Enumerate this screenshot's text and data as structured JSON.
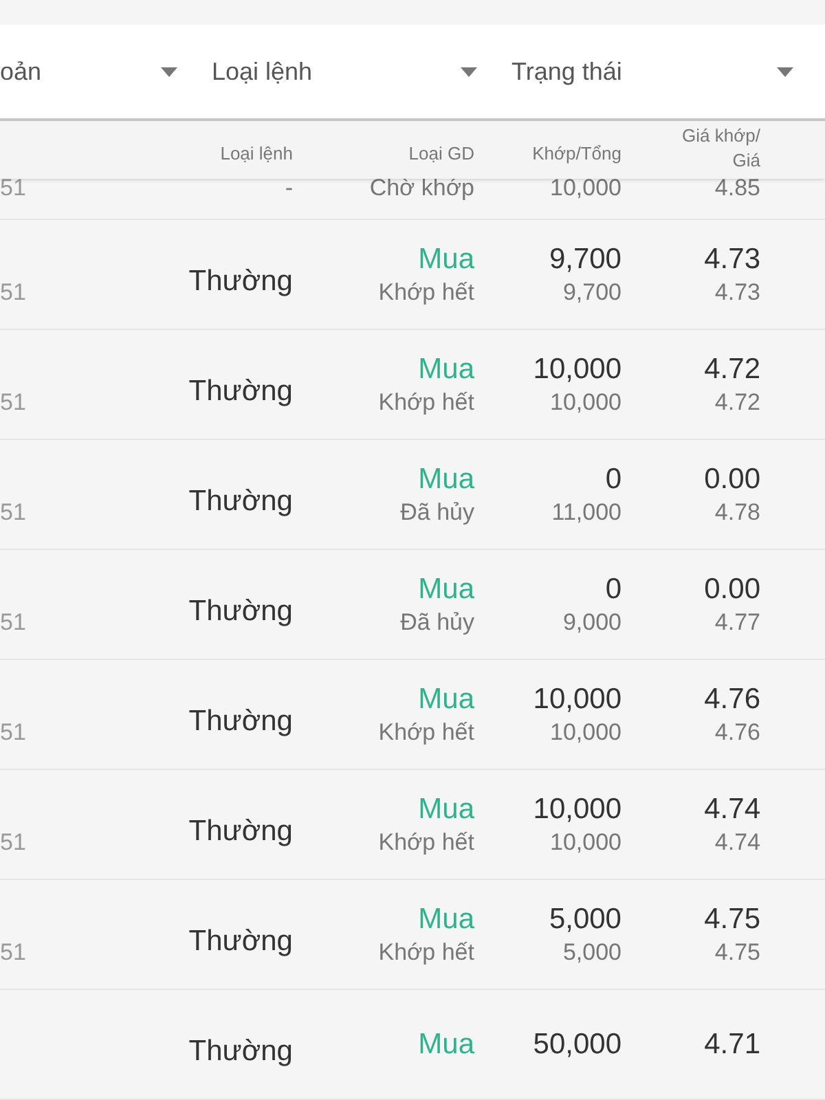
{
  "filters": [
    {
      "label": "oản"
    },
    {
      "label": "Loại lệnh"
    },
    {
      "label": "Trạng thái"
    }
  ],
  "columns": {
    "order_type": "Loại lệnh",
    "trade_type": "Loại GD",
    "quantity": "Khớp/Tổng",
    "price": "Giá khớp/\nGiá"
  },
  "partial_row": {
    "column_1": "51",
    "order_type": "-",
    "status": "Chờ khớp",
    "total": "10,000",
    "price": "4.85"
  },
  "rows": [
    {
      "column_1": "51",
      "order_type": "Thường",
      "side": "Mua",
      "status": "Khớp hết",
      "matched": "9,700",
      "total": "9,700",
      "matched_price": "4.73",
      "price": "4.73"
    },
    {
      "column_1": "51",
      "order_type": "Thường",
      "side": "Mua",
      "status": "Khớp hết",
      "matched": "10,000",
      "total": "10,000",
      "matched_price": "4.72",
      "price": "4.72"
    },
    {
      "column_1": "51",
      "order_type": "Thường",
      "side": "Mua",
      "status": "Đã hủy",
      "matched": "0",
      "total": "11,000",
      "matched_price": "0.00",
      "price": "4.78"
    },
    {
      "column_1": "51",
      "order_type": "Thường",
      "side": "Mua",
      "status": "Đã hủy",
      "matched": "0",
      "total": "9,000",
      "matched_price": "0.00",
      "price": "4.77"
    },
    {
      "column_1": "51",
      "order_type": "Thường",
      "side": "Mua",
      "status": "Khớp hết",
      "matched": "10,000",
      "total": "10,000",
      "matched_price": "4.76",
      "price": "4.76"
    },
    {
      "column_1": "51",
      "order_type": "Thường",
      "side": "Mua",
      "status": "Khớp hết",
      "matched": "10,000",
      "total": "10,000",
      "matched_price": "4.74",
      "price": "4.74"
    },
    {
      "column_1": "51",
      "order_type": "Thường",
      "side": "Mua",
      "status": "Khớp hết",
      "matched": "5,000",
      "total": "5,000",
      "matched_price": "4.75",
      "price": "4.75"
    },
    {
      "order_type": "Thường",
      "side": "Mua",
      "matched": "50,000",
      "matched_price": "4.71"
    }
  ]
}
